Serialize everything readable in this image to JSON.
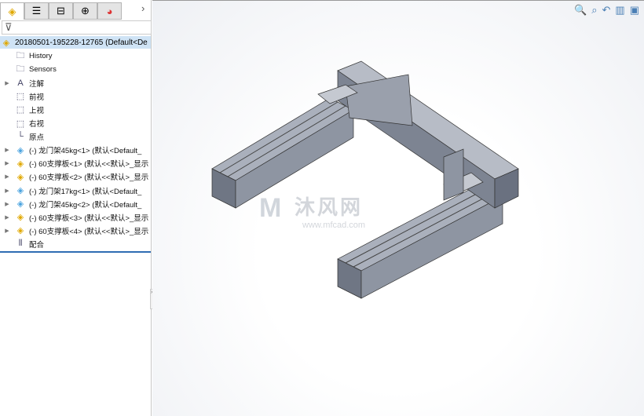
{
  "tabs": [
    {
      "icon": "feature-manager-icon"
    },
    {
      "icon": "property-manager-icon"
    },
    {
      "icon": "configuration-manager-icon"
    },
    {
      "icon": "dimxpert-icon"
    },
    {
      "icon": "display-manager-icon"
    }
  ],
  "tree": {
    "root": "20180501-195228-12765  (Default<De",
    "items": [
      {
        "label": "History",
        "icon": "history-folder-icon",
        "expandable": false
      },
      {
        "label": "Sensors",
        "icon": "sensors-folder-icon",
        "expandable": false
      },
      {
        "label": "注解",
        "icon": "annotations-icon",
        "expandable": true
      },
      {
        "label": "前视",
        "icon": "plane-icon",
        "expandable": false
      },
      {
        "label": "上视",
        "icon": "plane-icon",
        "expandable": false
      },
      {
        "label": "右视",
        "icon": "plane-icon",
        "expandable": false
      },
      {
        "label": "原点",
        "icon": "origin-icon",
        "expandable": false
      },
      {
        "label": "(-) 龙门架45kg<1> (默认<Default_",
        "icon": "subassembly-icon",
        "expandable": true
      },
      {
        "label": "(-) 60支撑板<1> (默认<<默认>_显示",
        "icon": "part-icon",
        "expandable": true
      },
      {
        "label": "(-) 60支撑板<2> (默认<<默认>_显示",
        "icon": "part-icon",
        "expandable": true
      },
      {
        "label": "(-) 龙门架17kg<1> (默认<Default_",
        "icon": "subassembly-icon",
        "expandable": true
      },
      {
        "label": "(-) 龙门架45kg<2> (默认<Default_",
        "icon": "subassembly-icon",
        "expandable": true
      },
      {
        "label": "(-) 60支撑板<3> (默认<<默认>_显示",
        "icon": "part-icon",
        "expandable": true
      },
      {
        "label": "(-) 60支撑板<4> (默认<<默认>_显示",
        "icon": "part-icon",
        "expandable": true
      },
      {
        "label": "配合",
        "icon": "mates-icon",
        "expandable": false
      }
    ]
  },
  "view_tools": [
    "zoom-to-fit-icon",
    "zoom-to-area-icon",
    "previous-view-icon",
    "section-view-icon",
    "view-orientation-icon"
  ],
  "watermark": {
    "title": "沐风网",
    "url": "www.mfcad.com"
  }
}
